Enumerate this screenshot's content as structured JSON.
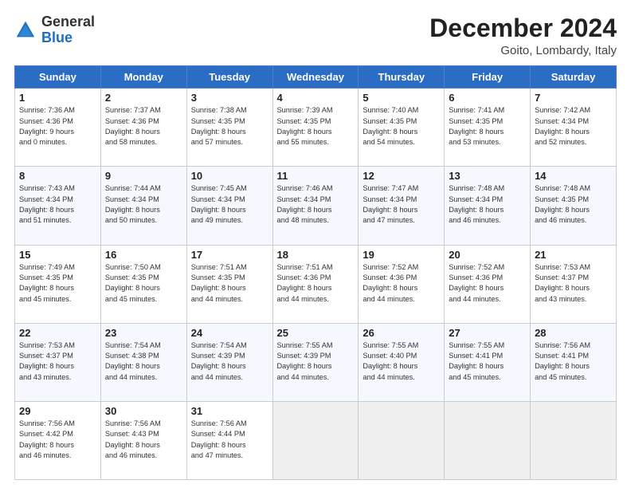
{
  "header": {
    "logo_general": "General",
    "logo_blue": "Blue",
    "month_title": "December 2024",
    "location": "Goito, Lombardy, Italy"
  },
  "days_of_week": [
    "Sunday",
    "Monday",
    "Tuesday",
    "Wednesday",
    "Thursday",
    "Friday",
    "Saturday"
  ],
  "weeks": [
    [
      {
        "day": "1",
        "info": "Sunrise: 7:36 AM\nSunset: 4:36 PM\nDaylight: 9 hours\nand 0 minutes."
      },
      {
        "day": "2",
        "info": "Sunrise: 7:37 AM\nSunset: 4:36 PM\nDaylight: 8 hours\nand 58 minutes."
      },
      {
        "day": "3",
        "info": "Sunrise: 7:38 AM\nSunset: 4:35 PM\nDaylight: 8 hours\nand 57 minutes."
      },
      {
        "day": "4",
        "info": "Sunrise: 7:39 AM\nSunset: 4:35 PM\nDaylight: 8 hours\nand 55 minutes."
      },
      {
        "day": "5",
        "info": "Sunrise: 7:40 AM\nSunset: 4:35 PM\nDaylight: 8 hours\nand 54 minutes."
      },
      {
        "day": "6",
        "info": "Sunrise: 7:41 AM\nSunset: 4:35 PM\nDaylight: 8 hours\nand 53 minutes."
      },
      {
        "day": "7",
        "info": "Sunrise: 7:42 AM\nSunset: 4:34 PM\nDaylight: 8 hours\nand 52 minutes."
      }
    ],
    [
      {
        "day": "8",
        "info": "Sunrise: 7:43 AM\nSunset: 4:34 PM\nDaylight: 8 hours\nand 51 minutes."
      },
      {
        "day": "9",
        "info": "Sunrise: 7:44 AM\nSunset: 4:34 PM\nDaylight: 8 hours\nand 50 minutes."
      },
      {
        "day": "10",
        "info": "Sunrise: 7:45 AM\nSunset: 4:34 PM\nDaylight: 8 hours\nand 49 minutes."
      },
      {
        "day": "11",
        "info": "Sunrise: 7:46 AM\nSunset: 4:34 PM\nDaylight: 8 hours\nand 48 minutes."
      },
      {
        "day": "12",
        "info": "Sunrise: 7:47 AM\nSunset: 4:34 PM\nDaylight: 8 hours\nand 47 minutes."
      },
      {
        "day": "13",
        "info": "Sunrise: 7:48 AM\nSunset: 4:34 PM\nDaylight: 8 hours\nand 46 minutes."
      },
      {
        "day": "14",
        "info": "Sunrise: 7:48 AM\nSunset: 4:35 PM\nDaylight: 8 hours\nand 46 minutes."
      }
    ],
    [
      {
        "day": "15",
        "info": "Sunrise: 7:49 AM\nSunset: 4:35 PM\nDaylight: 8 hours\nand 45 minutes."
      },
      {
        "day": "16",
        "info": "Sunrise: 7:50 AM\nSunset: 4:35 PM\nDaylight: 8 hours\nand 45 minutes."
      },
      {
        "day": "17",
        "info": "Sunrise: 7:51 AM\nSunset: 4:35 PM\nDaylight: 8 hours\nand 44 minutes."
      },
      {
        "day": "18",
        "info": "Sunrise: 7:51 AM\nSunset: 4:36 PM\nDaylight: 8 hours\nand 44 minutes."
      },
      {
        "day": "19",
        "info": "Sunrise: 7:52 AM\nSunset: 4:36 PM\nDaylight: 8 hours\nand 44 minutes."
      },
      {
        "day": "20",
        "info": "Sunrise: 7:52 AM\nSunset: 4:36 PM\nDaylight: 8 hours\nand 44 minutes."
      },
      {
        "day": "21",
        "info": "Sunrise: 7:53 AM\nSunset: 4:37 PM\nDaylight: 8 hours\nand 43 minutes."
      }
    ],
    [
      {
        "day": "22",
        "info": "Sunrise: 7:53 AM\nSunset: 4:37 PM\nDaylight: 8 hours\nand 43 minutes."
      },
      {
        "day": "23",
        "info": "Sunrise: 7:54 AM\nSunset: 4:38 PM\nDaylight: 8 hours\nand 44 minutes."
      },
      {
        "day": "24",
        "info": "Sunrise: 7:54 AM\nSunset: 4:39 PM\nDaylight: 8 hours\nand 44 minutes."
      },
      {
        "day": "25",
        "info": "Sunrise: 7:55 AM\nSunset: 4:39 PM\nDaylight: 8 hours\nand 44 minutes."
      },
      {
        "day": "26",
        "info": "Sunrise: 7:55 AM\nSunset: 4:40 PM\nDaylight: 8 hours\nand 44 minutes."
      },
      {
        "day": "27",
        "info": "Sunrise: 7:55 AM\nSunset: 4:41 PM\nDaylight: 8 hours\nand 45 minutes."
      },
      {
        "day": "28",
        "info": "Sunrise: 7:56 AM\nSunset: 4:41 PM\nDaylight: 8 hours\nand 45 minutes."
      }
    ],
    [
      {
        "day": "29",
        "info": "Sunrise: 7:56 AM\nSunset: 4:42 PM\nDaylight: 8 hours\nand 46 minutes."
      },
      {
        "day": "30",
        "info": "Sunrise: 7:56 AM\nSunset: 4:43 PM\nDaylight: 8 hours\nand 46 minutes."
      },
      {
        "day": "31",
        "info": "Sunrise: 7:56 AM\nSunset: 4:44 PM\nDaylight: 8 hours\nand 47 minutes."
      },
      null,
      null,
      null,
      null
    ]
  ]
}
